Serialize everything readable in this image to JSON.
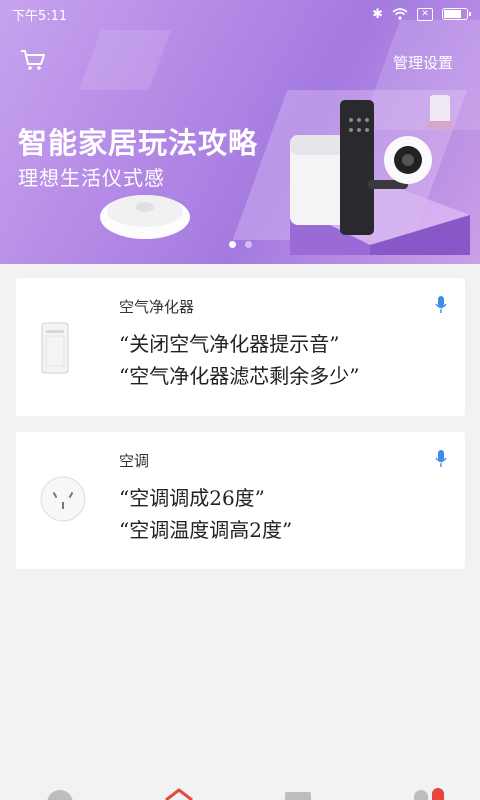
{
  "status_bar": {
    "time": "下午5:11"
  },
  "header": {
    "manage_label": "管理设置"
  },
  "banner": {
    "title": "智能家居玩法攻略",
    "subtitle": "理想生活仪式感",
    "dots": 2,
    "active_dot": 0
  },
  "cards": [
    {
      "category": "空气净化器",
      "phrases": [
        "“关闭空气净化器提示音”",
        "“空气净化器滤芯剩余多少”"
      ],
      "device_icon": "air-purifier-icon"
    },
    {
      "category": "空调",
      "phrases": [
        "“空调调成26度”",
        "“空调温度调高2度”"
      ],
      "device_icon": "ac-socket-icon"
    }
  ],
  "colors": {
    "accent_mic": "#3a8ee6",
    "banner_purple": "#b48ae6",
    "nav_red": "#e8463a"
  }
}
